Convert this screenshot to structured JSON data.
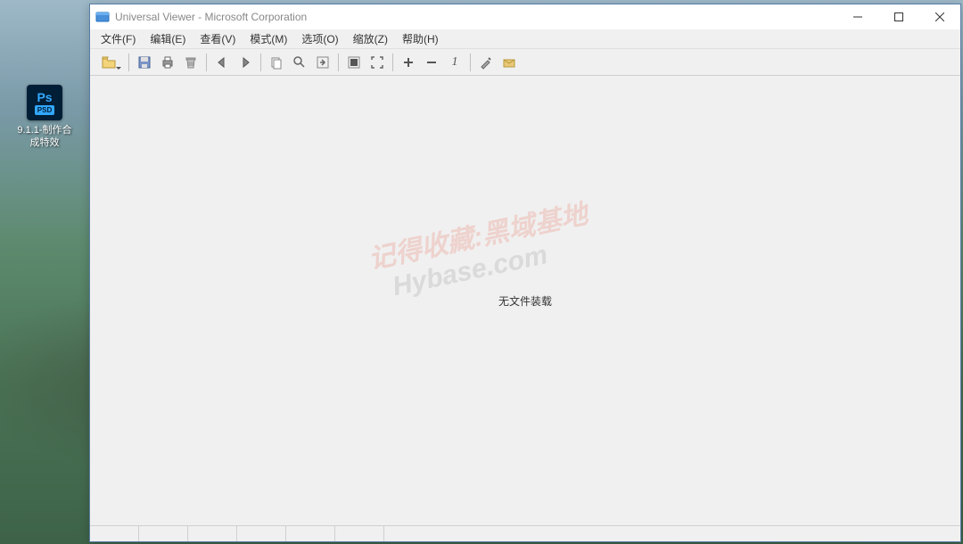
{
  "desktop": {
    "icon_label": "9.1.1-制作合成特效",
    "icon_type": "PSD",
    "icon_ps": "Ps"
  },
  "window": {
    "title": "Universal Viewer - Microsoft Corporation"
  },
  "menu": {
    "file": "文件(F)",
    "edit": "编辑(E)",
    "view": "查看(V)",
    "mode": "模式(M)",
    "options": "选项(O)",
    "zoom": "缩放(Z)",
    "help": "帮助(H)"
  },
  "toolbar": {
    "zoom_label": "1"
  },
  "content": {
    "empty_msg": "无文件装载"
  },
  "watermark": {
    "line1": "记得收藏:黑域基地",
    "line2": "Hybase.com"
  }
}
